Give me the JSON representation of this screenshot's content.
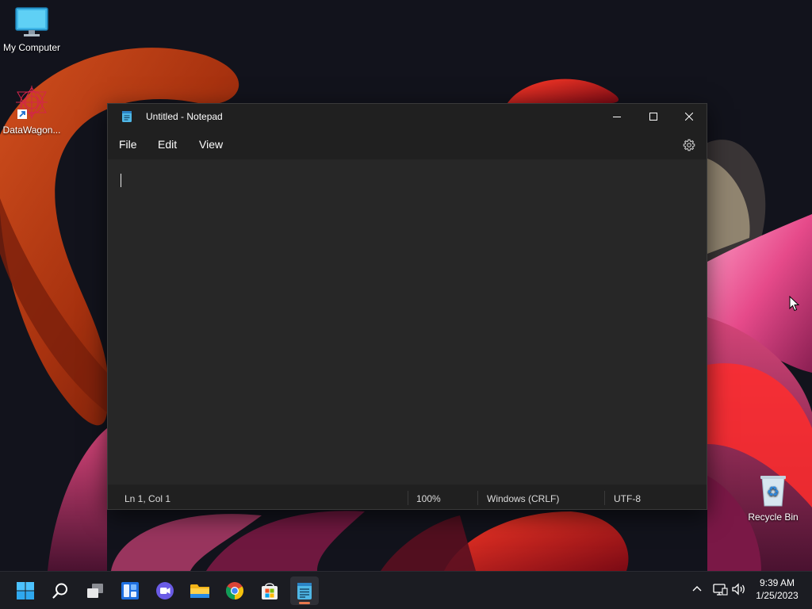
{
  "desktop": {
    "icons": [
      {
        "label": "My Computer"
      },
      {
        "label": "DataWagon..."
      },
      {
        "label": "Recycle Bin"
      }
    ]
  },
  "window": {
    "title": "Untitled - Notepad",
    "menu": {
      "file": "File",
      "edit": "Edit",
      "view": "View"
    },
    "content": "",
    "status": {
      "position": "Ln 1, Col 1",
      "zoom": "100%",
      "line_ending": "Windows (CRLF)",
      "encoding": "UTF-8"
    }
  },
  "taskbar": {
    "apps": [
      "start-icon",
      "search-icon",
      "task-view-icon",
      "widgets-icon",
      "chat-icon",
      "file-explorer-icon",
      "chrome-icon",
      "store-icon",
      "notepad-icon"
    ],
    "running": "notepad",
    "accent_color": "#e8774d"
  },
  "clock": {
    "time": "9:39 AM",
    "date": "1/25/2023"
  }
}
